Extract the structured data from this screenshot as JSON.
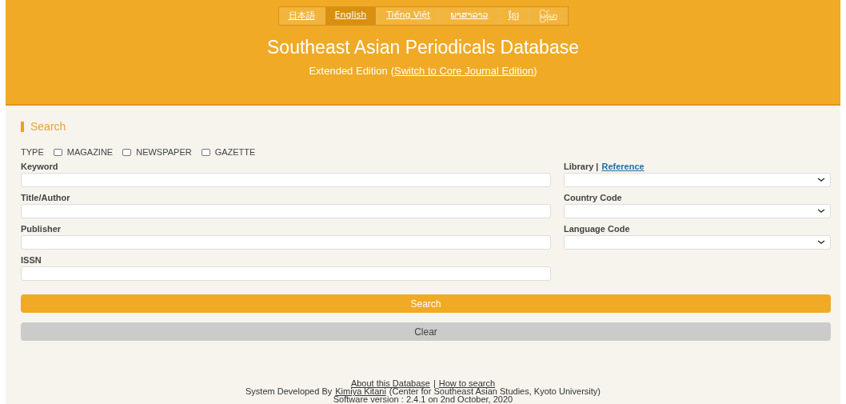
{
  "languages": [
    {
      "label": "日本語",
      "selected": false
    },
    {
      "label": "English",
      "selected": true
    },
    {
      "label": "Tiếng Việt",
      "selected": false
    },
    {
      "label": "ພາສາລາວ",
      "selected": false
    },
    {
      "label": "ខ្មែរ",
      "selected": false
    },
    {
      "label": "မြန်မာ",
      "selected": false
    }
  ],
  "header": {
    "title": "Southeast Asian Periodicals Database",
    "edition": "Extended Edition",
    "switch_open": "(",
    "switch_link": "Switch to Core Journal Edition",
    "switch_close": ")"
  },
  "section_title": "Search",
  "type": {
    "label": "TYPE",
    "options": [
      {
        "label": "MAGAZINE",
        "checked": false
      },
      {
        "label": "NEWSPAPER",
        "checked": false
      },
      {
        "label": "GAZETTE",
        "checked": false
      }
    ]
  },
  "text_fields": [
    {
      "label": "Keyword"
    },
    {
      "label": "Title/Author"
    },
    {
      "label": "Publisher"
    },
    {
      "label": "ISSN"
    }
  ],
  "select_fields": [
    {
      "label": "Library",
      "separator": "|",
      "link": "Reference"
    },
    {
      "label": "Country Code"
    },
    {
      "label": "Language Code"
    }
  ],
  "buttons": [
    {
      "label": "Search",
      "kind": "primary"
    },
    {
      "label": "Clear",
      "kind": "secondary"
    }
  ],
  "footer": {
    "links": [
      "About this Database",
      "How to search"
    ],
    "separator": "|",
    "developed_prefix": "System Developed By",
    "developer": "Kimiya Kitani",
    "affiliation": "(Center for Southeast Asian Studies, Kyoto University)",
    "version": "Software version : 2.4.1 on 2nd October, 2020"
  }
}
